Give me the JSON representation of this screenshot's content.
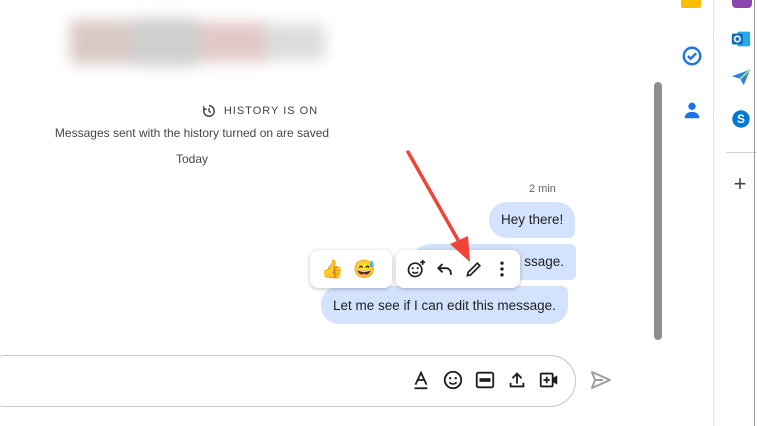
{
  "history": {
    "title": "HISTORY IS ON",
    "subtitle": "Messages sent with the history turned on are saved",
    "date_label": "Today"
  },
  "messages": {
    "timestamp": "2 min",
    "items": [
      {
        "text": "Hey there!"
      },
      {
        "text": "ssage."
      },
      {
        "text": "Let me see if I can edit this message."
      }
    ]
  },
  "reactions": {
    "quick": [
      {
        "icon": "thumbs-up-emoji",
        "glyph": "👍"
      },
      {
        "icon": "sweat-smile-emoji",
        "glyph": "😅"
      }
    ],
    "actions": [
      {
        "icon": "add-reaction-icon"
      },
      {
        "icon": "reply-icon"
      },
      {
        "icon": "edit-pencil-icon"
      },
      {
        "icon": "more-vert-icon"
      }
    ]
  },
  "compose": {
    "icons": [
      "text-format-icon",
      "emoji-icon",
      "gif-icon",
      "upload-icon",
      "video-call-icon"
    ],
    "send_icon": "send-icon"
  },
  "side_rail": {
    "icons": [
      "keep-icon",
      "tasks-icon",
      "contacts-icon"
    ]
  },
  "edge_apps": {
    "icons": [
      "app-icon",
      "outlook-icon",
      "send-app-icon",
      "skype-icon",
      "add-icon"
    ],
    "add_label": "+"
  },
  "colors": {
    "bubble": "#d3e3fd",
    "accent_blue": "#1a73e8",
    "annotation_arrow": "#f04438"
  }
}
